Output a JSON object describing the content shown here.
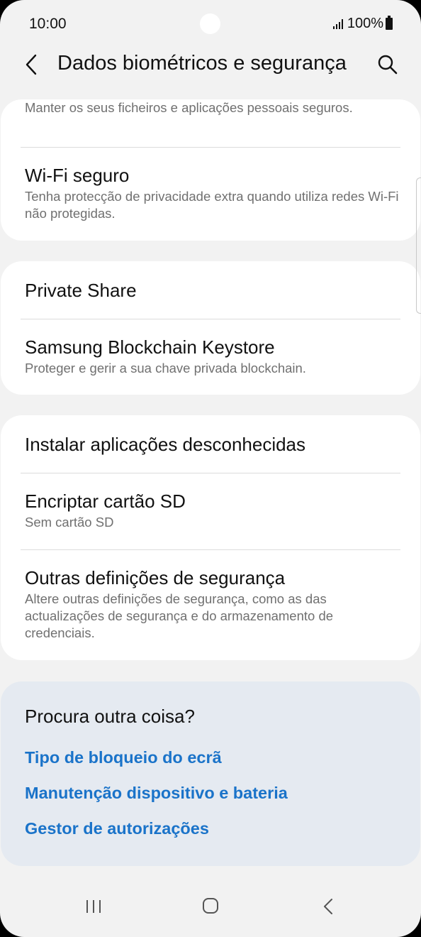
{
  "status": {
    "time": "10:00",
    "battery": "100%"
  },
  "header": {
    "title": "Dados biométricos e segurança"
  },
  "group1": {
    "partial_sub": "Manter os seus ficheiros e aplicações pessoais seguros.",
    "items": [
      {
        "title": "Wi-Fi seguro",
        "subtitle": "Tenha protecção de privacidade extra quando utiliza redes Wi-Fi não protegidas."
      }
    ]
  },
  "group2": {
    "items": [
      {
        "title": "Private Share"
      },
      {
        "title": "Samsung Blockchain Keystore",
        "subtitle": "Proteger e gerir a sua chave privada blockchain."
      }
    ]
  },
  "group3": {
    "items": [
      {
        "title": "Instalar aplicações desconhecidas"
      },
      {
        "title": "Encriptar cartão SD",
        "subtitle": "Sem cartão SD"
      },
      {
        "title": "Outras definições de segurança",
        "subtitle": "Altere outras definições de segurança, como as das actualizações de segurança e do armazenamento de credenciais."
      }
    ]
  },
  "suggestions": {
    "title": "Procura outra coisa?",
    "links": [
      "Tipo de bloqueio do ecrã",
      "Manutenção dispositivo e bateria",
      "Gestor de autorizações"
    ]
  },
  "colors": {
    "link": "#1a73c9",
    "card": "#ffffff",
    "background": "#f2f2f2",
    "suggest_bg": "#e5eaf1"
  }
}
